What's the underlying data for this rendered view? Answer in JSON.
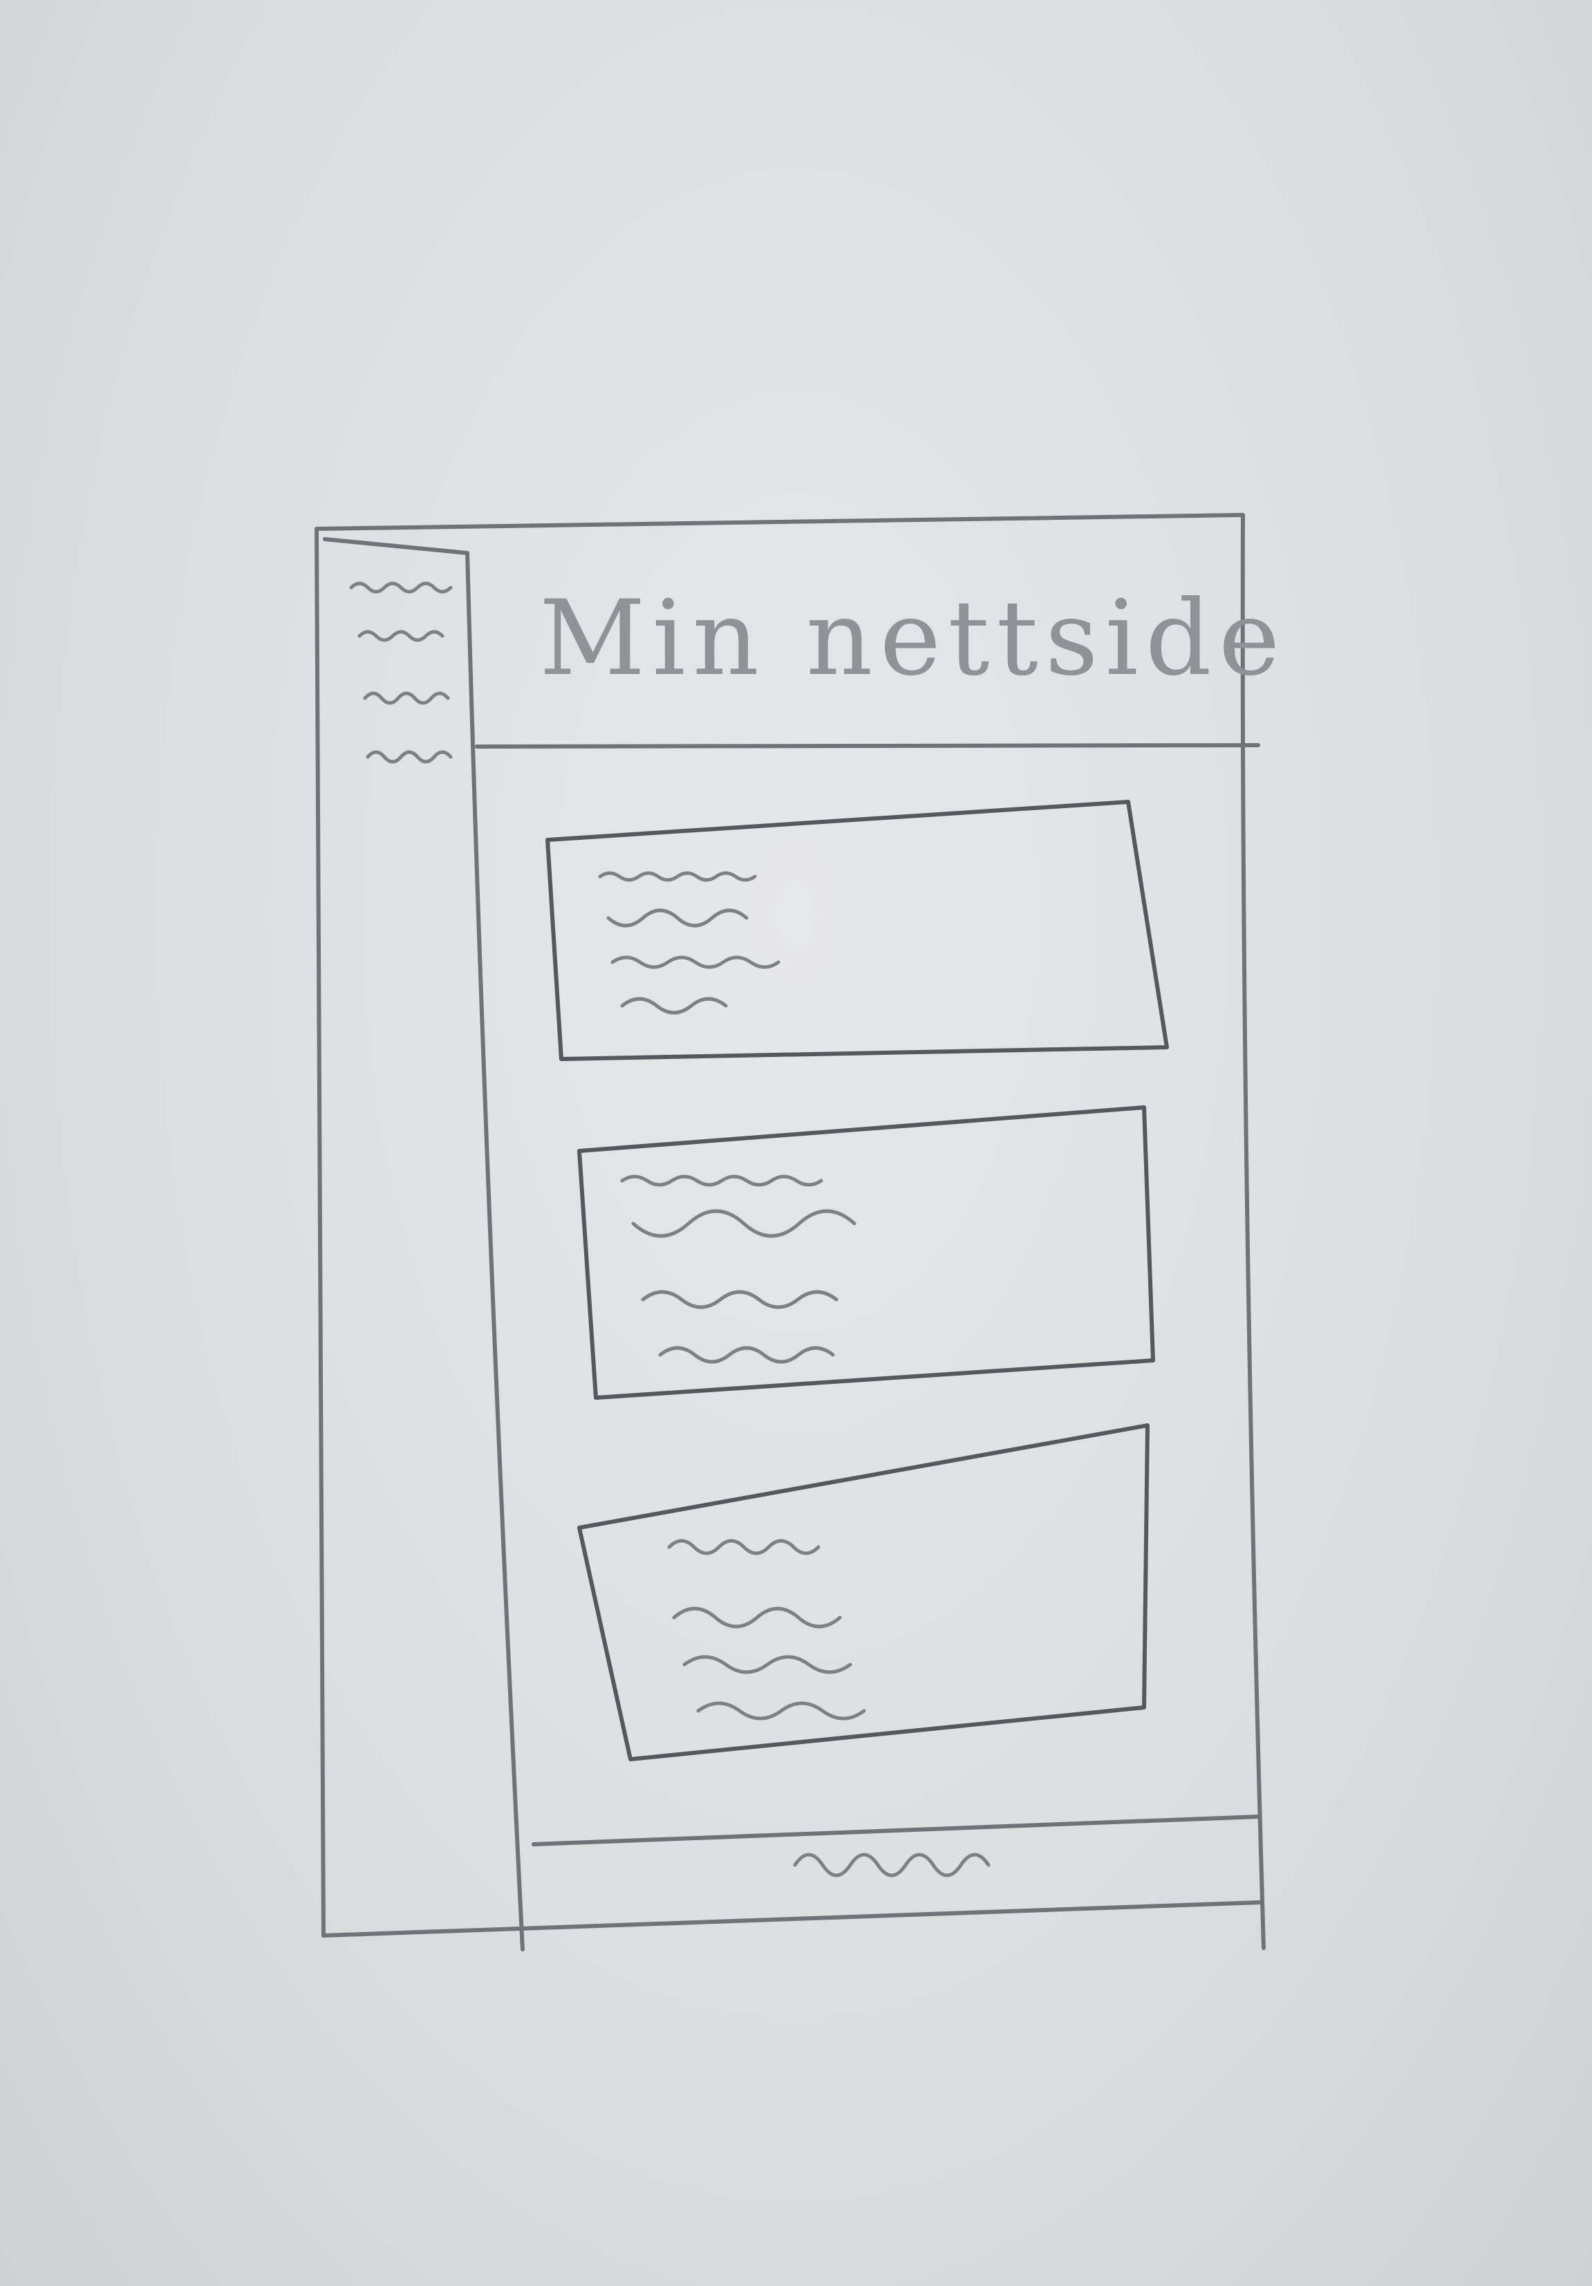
{
  "header": {
    "title": "Min nettside"
  },
  "sidebar": {
    "items": [
      {
        "scribble": "nav-item-1"
      },
      {
        "scribble": "nav-item-2"
      },
      {
        "scribble": "nav-item-3"
      },
      {
        "scribble": "nav-item-4"
      }
    ]
  },
  "main": {
    "cards": [
      {
        "lines": 4
      },
      {
        "lines": 4
      },
      {
        "lines": 4
      }
    ]
  },
  "footer": {
    "scribble": "footer-text"
  },
  "colors": {
    "paper": "#dcdee0",
    "pencil": "#6f7276"
  }
}
